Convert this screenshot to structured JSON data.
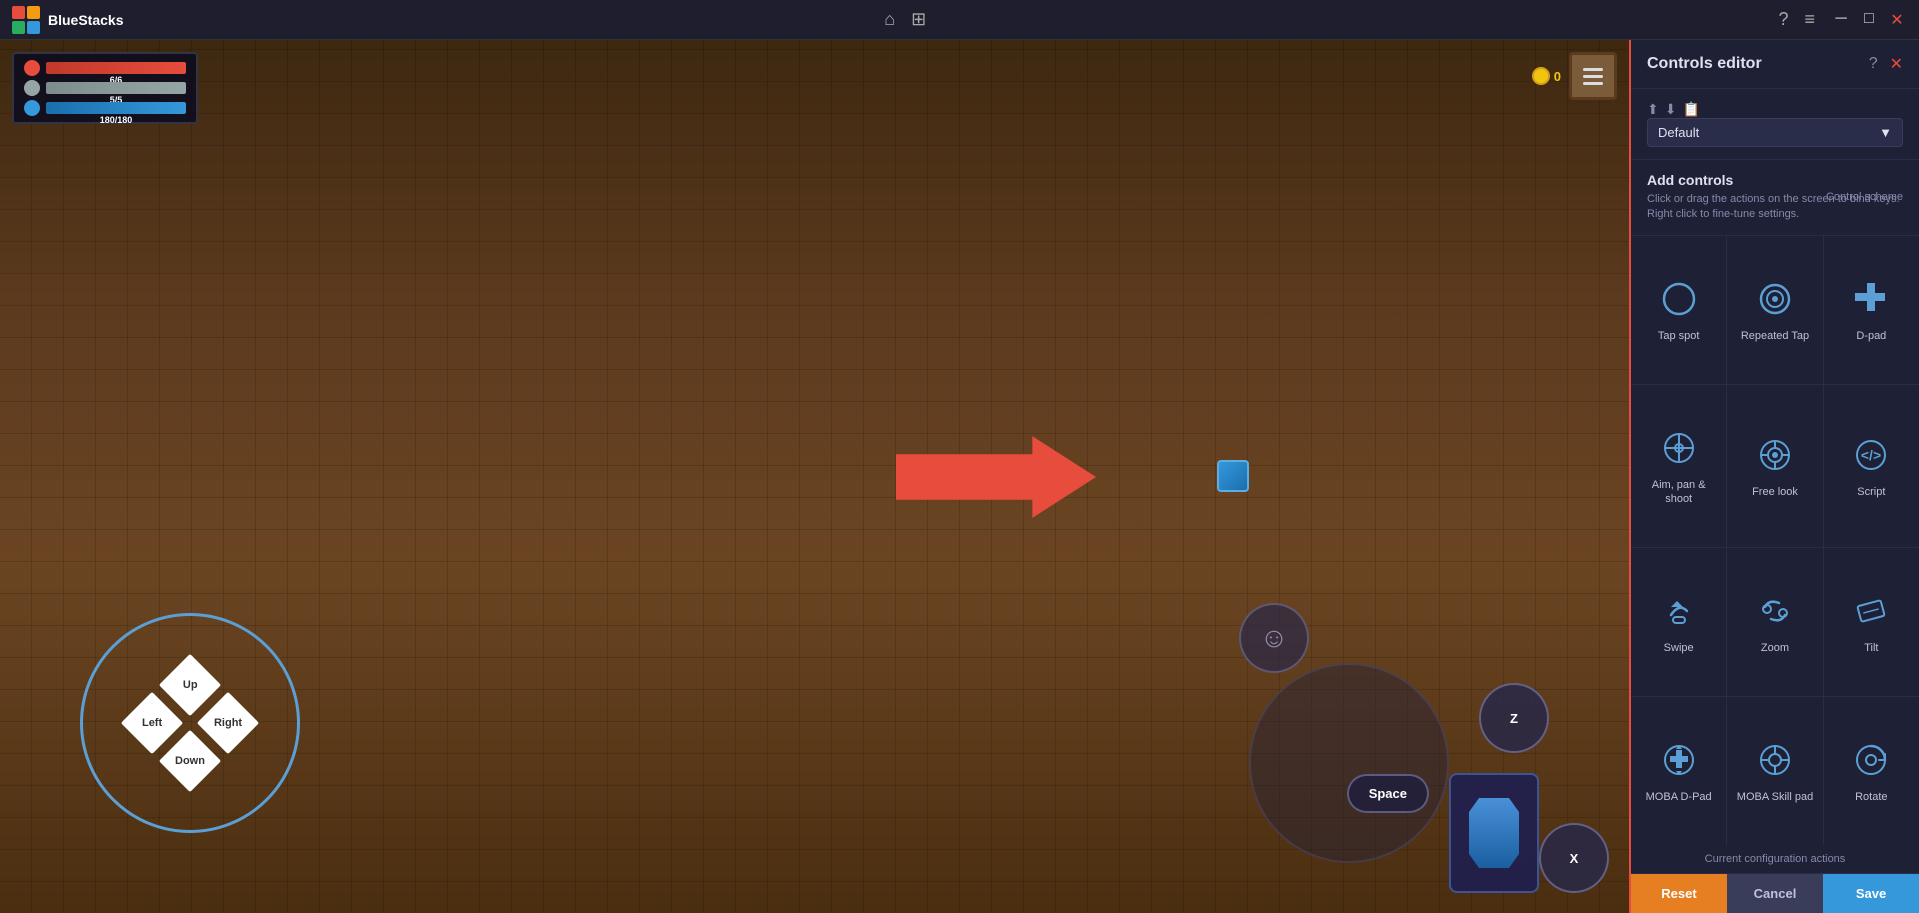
{
  "titleBar": {
    "appName": "BlueStacks",
    "homeIcon": "🏠",
    "windowIcon": "⊞"
  },
  "hud": {
    "hp": "6/6",
    "mp": "5/5",
    "sp": "180/180",
    "coins": "0"
  },
  "dpad": {
    "up": "Up",
    "down": "Down",
    "left": "Left",
    "right": "Right"
  },
  "actionButtons": {
    "z": "Z",
    "x": "X",
    "space": "Space"
  },
  "controlsPanel": {
    "title": "Controls editor",
    "schemeLabel": "Control scheme",
    "schemeValue": "Default",
    "addControlsTitle": "Add controls",
    "addControlsDesc": "Click or drag the actions on the screen to bind keys. Right click to fine-tune settings.",
    "footerLabel": "Current configuration actions",
    "resetBtn": "Reset",
    "cancelBtn": "Cancel",
    "saveBtn": "Save",
    "controls": [
      {
        "id": "tap-spot",
        "label": "Tap spot"
      },
      {
        "id": "repeated-tap",
        "label": "Repeated\nTap"
      },
      {
        "id": "d-pad",
        "label": "D-pad"
      },
      {
        "id": "aim-pan-shoot",
        "label": "Aim, pan &\nshoot"
      },
      {
        "id": "free-look",
        "label": "Free look"
      },
      {
        "id": "script",
        "label": "Script"
      },
      {
        "id": "swipe",
        "label": "Swipe"
      },
      {
        "id": "zoom",
        "label": "Zoom"
      },
      {
        "id": "tilt",
        "label": "Tilt"
      },
      {
        "id": "moba-dpad",
        "label": "MOBA D-Pad"
      },
      {
        "id": "moba-skill",
        "label": "MOBA Skill\npad"
      },
      {
        "id": "rotate",
        "label": "Rotate"
      }
    ]
  }
}
